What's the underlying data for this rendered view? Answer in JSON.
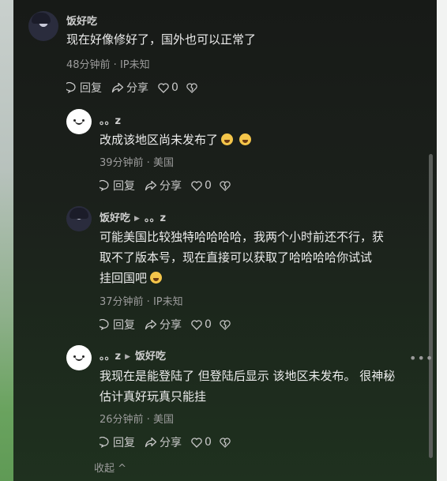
{
  "comments": [
    {
      "author": "饭好吃",
      "text": "现在好像修好了，国外也可以正常了",
      "meta": "48分钟前 · IP未知",
      "reply_label": "回复",
      "share_label": "分享",
      "likes": "0",
      "avatar": "anime-avatar"
    },
    {
      "author": "。。z",
      "text": "改成该地区尚未发布了",
      "emojis": [
        "crying-emoji",
        "crying-emoji"
      ],
      "meta": "39分钟前 · 美国",
      "reply_label": "回复",
      "share_label": "分享",
      "likes": "0",
      "avatar": "smiley-avatar"
    },
    {
      "author": "饭好吃",
      "reply_to": "。。z",
      "text_lines": [
        "可能美国比较独特哈哈哈哈，我两个小时前还不行，获",
        "取不了版本号，现在直接可以获取了哈哈哈哈你试试",
        "挂回国吧"
      ],
      "emoji": "laughing-emoji",
      "meta": "37分钟前 · IP未知",
      "reply_label": "回复",
      "share_label": "分享",
      "likes": "0",
      "avatar": "anime-avatar"
    },
    {
      "author": "。。z",
      "reply_to": "饭好吃",
      "text_lines": [
        "我现在是能登陆了 但登陆后显示 该地区未发布。 很神秘",
        "估计真好玩真只能挂"
      ],
      "meta": "26分钟前 · 美国",
      "reply_label": "回复",
      "share_label": "分享",
      "likes": "0",
      "avatar": "smiley-avatar"
    }
  ],
  "more_icon": "ellipsis-icon",
  "collapse_label": "收起 ^",
  "colors": {
    "panel": "#1b201b",
    "text": "#ececec",
    "meta": "#9c9c9c"
  }
}
